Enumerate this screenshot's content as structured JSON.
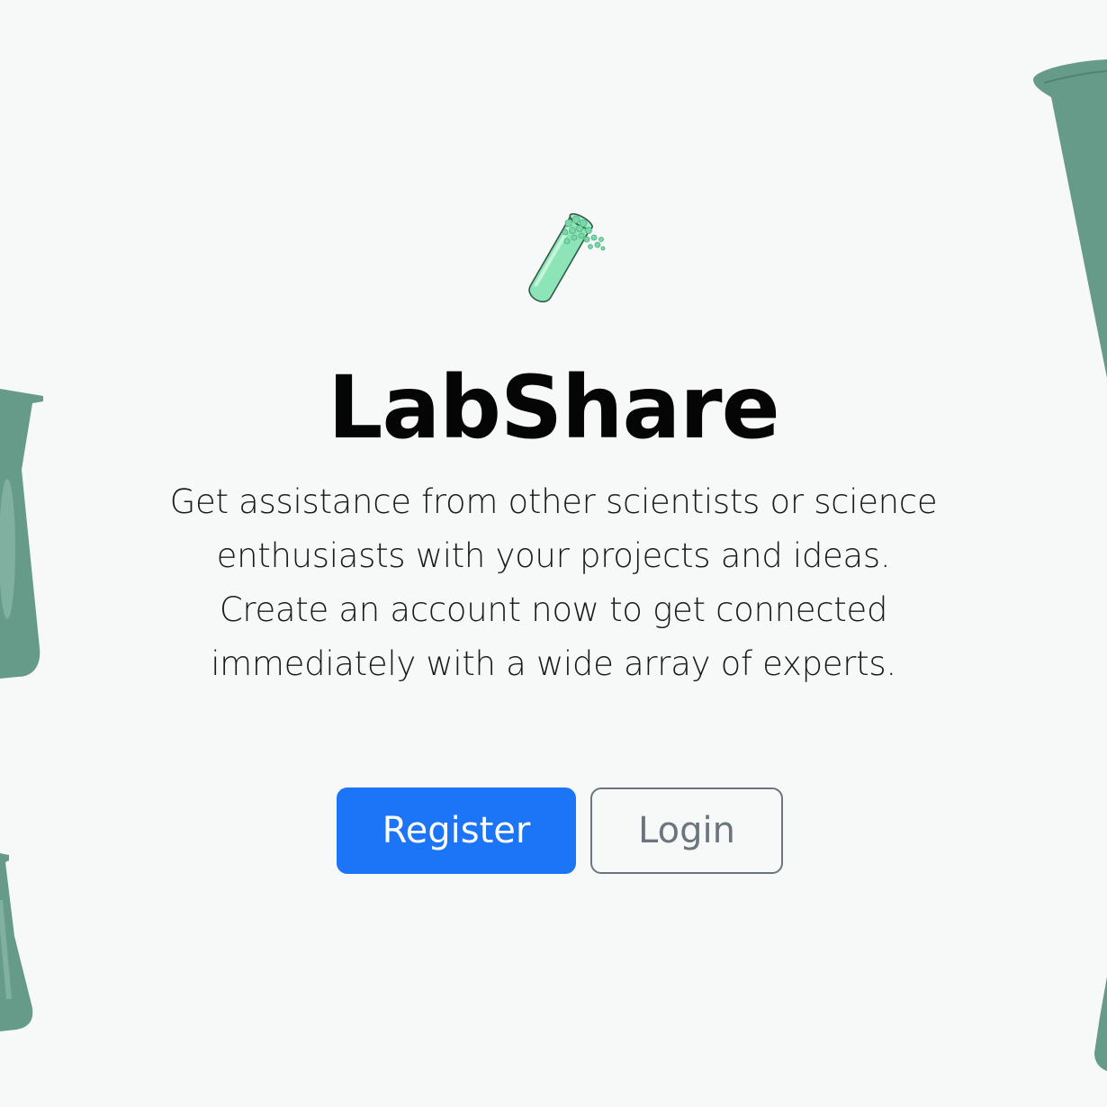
{
  "app": {
    "title": "LabShare",
    "tagline": "Get assistance from other scientists or science enthusiasts with your projects and ideas. Create an account now to get connected immediately with a wide array of experts.",
    "logo_icon": "test-tube-icon"
  },
  "actions": {
    "register_label": "Register",
    "login_label": "Login"
  },
  "decorations": {
    "beaker_icon": "beaker-icon"
  },
  "colors": {
    "background": "#f6f9f8",
    "primary": "#1c74f7",
    "secondary": "#6c757d",
    "beaker": "#669b8a",
    "tube": "#8de4b6"
  }
}
